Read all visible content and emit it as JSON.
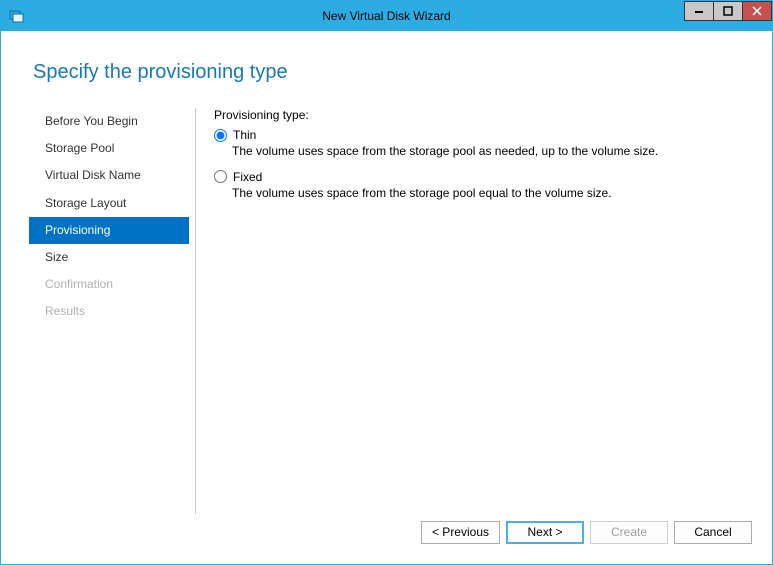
{
  "window": {
    "title": "New Virtual Disk Wizard"
  },
  "page": {
    "title": "Specify the provisioning type"
  },
  "steps": [
    {
      "label": "Before You Begin",
      "state": "done"
    },
    {
      "label": "Storage Pool",
      "state": "done"
    },
    {
      "label": "Virtual Disk Name",
      "state": "done"
    },
    {
      "label": "Storage Layout",
      "state": "done"
    },
    {
      "label": "Provisioning",
      "state": "active"
    },
    {
      "label": "Size",
      "state": "done"
    },
    {
      "label": "Confirmation",
      "state": "disabled"
    },
    {
      "label": "Results",
      "state": "disabled"
    }
  ],
  "provisioning": {
    "sectionLabel": "Provisioning type:",
    "options": [
      {
        "value": "thin",
        "label": "Thin",
        "description": "The volume uses space from the storage pool as needed, up to the volume size.",
        "selected": true
      },
      {
        "value": "fixed",
        "label": "Fixed",
        "description": "The volume uses space from the storage pool equal to the volume size.",
        "selected": false
      }
    ]
  },
  "buttons": {
    "previous": "< Previous",
    "next": "Next >",
    "create": "Create",
    "cancel": "Cancel"
  }
}
